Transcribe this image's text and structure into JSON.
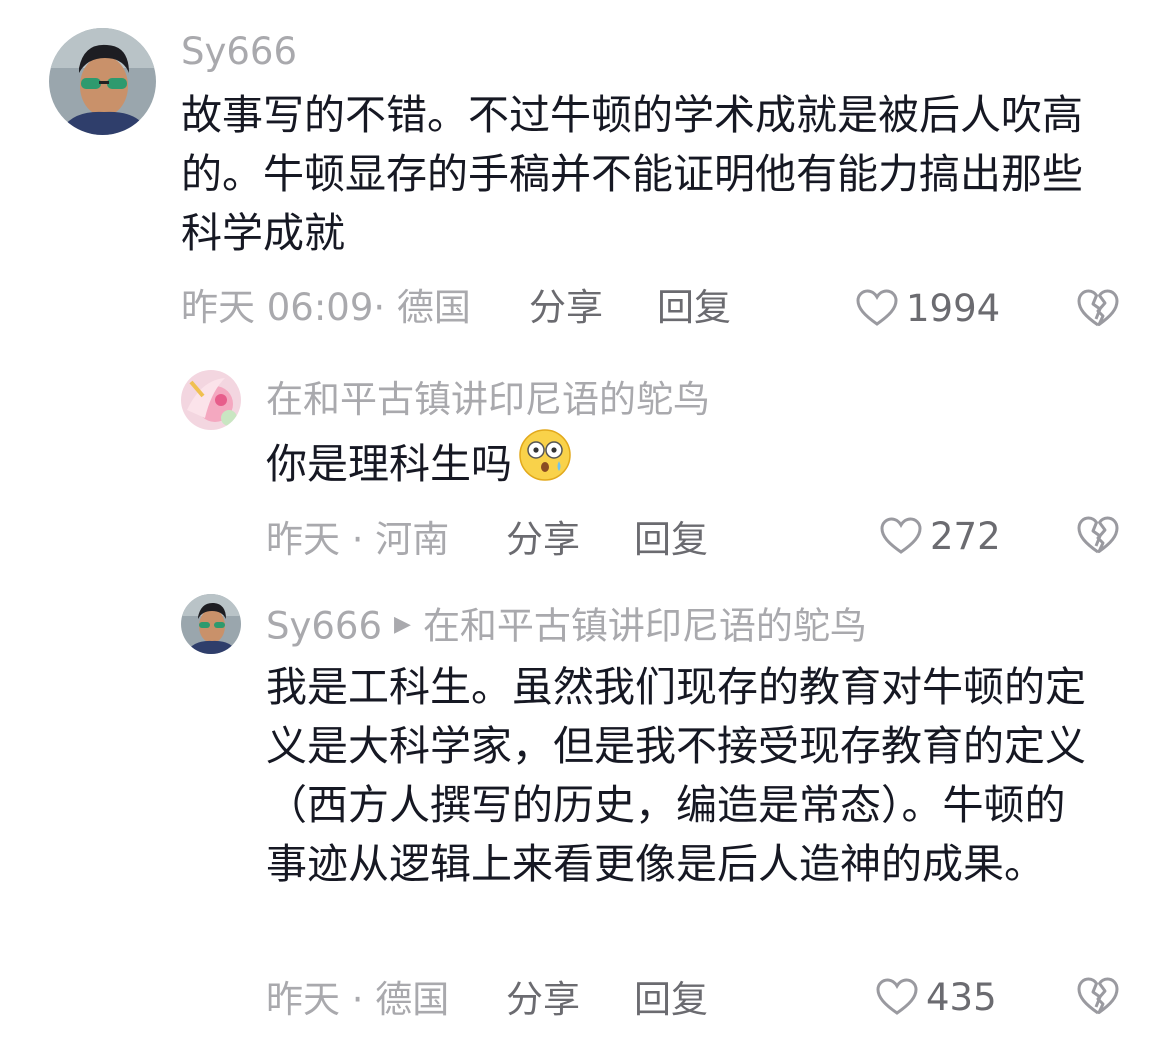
{
  "comments": [
    {
      "username": "Sy666",
      "text": "故事写的不错。不过牛顿的学术成就是被后人吹高的。牛顿显存的手稿并不能证明他有能力搞出那些科学成就",
      "time": "昨天 06:09· 德国",
      "share_label": "分享",
      "reply_label": "回复",
      "likes": "1994"
    },
    {
      "username": "在和平古镇讲印尼语的鸵鸟",
      "text": "你是理科生吗",
      "time": "昨天 · 河南",
      "share_label": "分享",
      "reply_label": "回复",
      "likes": "272"
    },
    {
      "username": "Sy666",
      "reply_to": "在和平古镇讲印尼语的鸵鸟",
      "text": "我是工科生。虽然我们现存的教育对牛顿的定义是大科学家，但是我不接受现存教育的定义（西方人撰写的历史，编造是常态）。牛顿的事迹从逻辑上来看更像是后人造神的成果。",
      "time": "昨天 · 德国",
      "share_label": "分享",
      "reply_label": "回复",
      "likes": "435"
    }
  ]
}
